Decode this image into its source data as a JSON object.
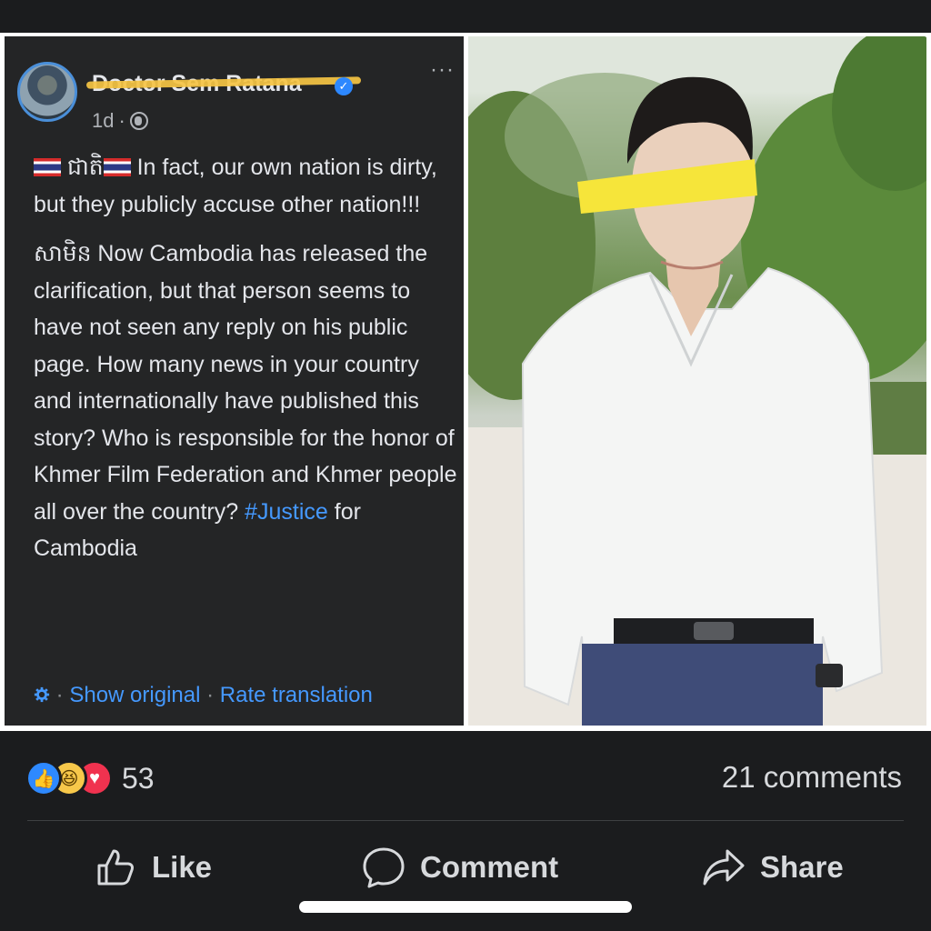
{
  "post": {
    "author": "Doctor Sem Ratana",
    "time": "1d",
    "meta_sep": "·",
    "paragraphs": [
      {
        "prefix": "ជាតិ",
        "text": " In fact, our own nation is dirty, but they publicly accuse other nation!!!"
      },
      {
        "prefix": "សាមិន",
        "text": " Now Cambodia has released the clarification, but that person seems to have not seen any reply on his public page. How many news in your country and internationally have published this story? Who is responsible for the honor of Khmer Film Federation and Khmer people all over the country? ",
        "hashtag": "#Justice",
        "suffix": " for Cambodia"
      }
    ],
    "show_original": "Show original",
    "rate_translation": "Rate translation",
    "sep": "·"
  },
  "stats": {
    "reaction_count": "53",
    "comments": "21 comments"
  },
  "actions": {
    "like": "Like",
    "comment": "Comment",
    "share": "Share"
  },
  "colors": {
    "background": "#1b1c1e",
    "panel": "#242526",
    "accent_blue": "#4599ff",
    "censor_yellow": "#f6e53a"
  }
}
